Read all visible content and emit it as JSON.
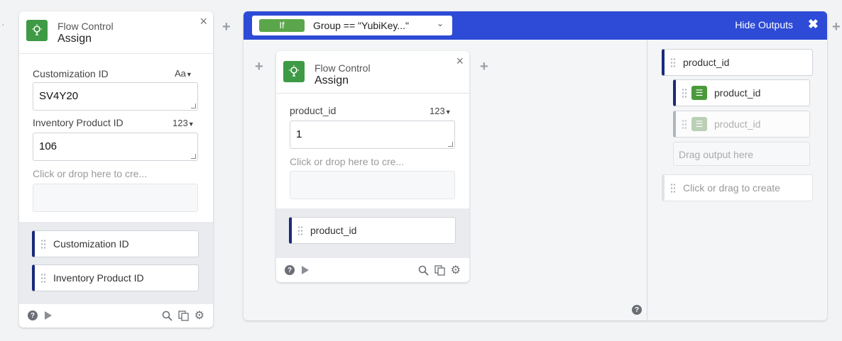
{
  "left_card": {
    "subtitle": "Flow Control",
    "title": "Assign",
    "close": "×",
    "fields": [
      {
        "label": "Customization ID",
        "type": "Aa",
        "value": "SV4Y20"
      },
      {
        "label": "Inventory Product ID",
        "type": "123",
        "value": "106"
      }
    ],
    "hint": "Click or drop here to cre...",
    "outputs": [
      "Customization ID",
      "Inventory Product ID"
    ]
  },
  "if_block": {
    "pill": "If",
    "condition": "Group  ==  \"YubiKey...\"",
    "hide_outputs": "Hide Outputs",
    "hide_x": "✖"
  },
  "inner_card": {
    "subtitle": "Flow Control",
    "title": "Assign",
    "close": "×",
    "field": {
      "label": "product_id",
      "type": "123",
      "value": "1"
    },
    "hint": "Click or drop here to cre...",
    "outputs": [
      "product_id"
    ]
  },
  "outputs_panel": {
    "group_label": "product_id",
    "items": [
      {
        "label": "product_id",
        "active": true
      },
      {
        "label": "product_id",
        "active": false
      }
    ],
    "drag_hint": "Drag output here",
    "create_hint": "Click or drag to create"
  },
  "colors": {
    "accent_blue": "#2d4bd6",
    "flow_green": "#3f9a45",
    "if_pill_green": "#5ba64a",
    "chip_border": "#1a2b7a"
  },
  "icons": [
    "lightbulb-icon",
    "close-icon",
    "plus-icon",
    "help-icon",
    "play-icon",
    "search-icon",
    "copy-icon",
    "gear-icon",
    "chevron-down-icon",
    "grip-icon",
    "sliders-icon"
  ]
}
